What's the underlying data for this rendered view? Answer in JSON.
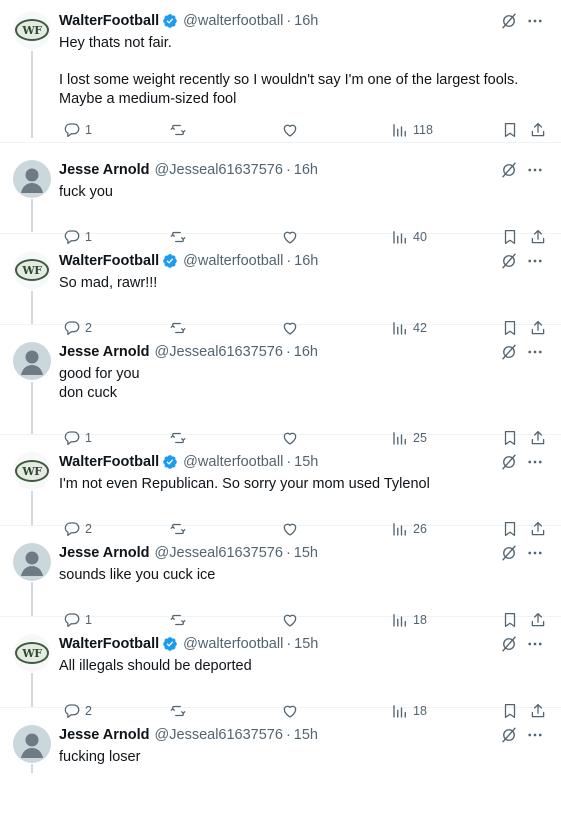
{
  "posts": [
    {
      "author": "WalterFootball",
      "handle": "@walterfootball",
      "time": "16h",
      "verified": true,
      "text": "Hey thats not fair.\n\nI lost some weight recently so I wouldn't say I'm one of the largest fools. Maybe a medium-sized fool",
      "replies": "1",
      "views": "118"
    },
    {
      "author": "Jesse Arnold",
      "handle": "@Jesseal61637576",
      "time": "16h",
      "verified": false,
      "text": "fuck you",
      "replies": "1",
      "views": "40"
    },
    {
      "author": "WalterFootball",
      "handle": "@walterfootball",
      "time": "16h",
      "verified": true,
      "text": "So mad, rawr!!!",
      "replies": "2",
      "views": "42"
    },
    {
      "author": "Jesse Arnold",
      "handle": "@Jesseal61637576",
      "time": "16h",
      "verified": false,
      "text": "good for you\ndon cuck",
      "replies": "1",
      "views": "25"
    },
    {
      "author": "WalterFootball",
      "handle": "@walterfootball",
      "time": "15h",
      "verified": true,
      "text": "I'm not even Republican. So sorry your mom used Tylenol",
      "replies": "2",
      "views": "26"
    },
    {
      "author": "Jesse Arnold",
      "handle": "@Jesseal61637576",
      "time": "15h",
      "verified": false,
      "text": "sounds like  you cuck ice",
      "replies": "1",
      "views": "18"
    },
    {
      "author": "WalterFootball",
      "handle": "@walterfootball",
      "time": "15h",
      "verified": true,
      "text": "All illegals should be deported",
      "replies": "2",
      "views": "18"
    },
    {
      "author": "Jesse Arnold",
      "handle": "@Jesseal61637576",
      "time": "15h",
      "verified": false,
      "text": "fucking loser",
      "replies": "",
      "views": ""
    }
  ],
  "avatar_logo_text": "WF",
  "colors": {
    "text": "#0f1419",
    "muted": "#536471",
    "verified": "#1d9bf0",
    "thread_line": "#cfd9de",
    "separator": "#eff3f4"
  },
  "icons": [
    "verified-badge-icon",
    "grok-icon",
    "more-icon",
    "reply-icon",
    "repost-icon",
    "like-icon",
    "views-icon",
    "bookmark-icon",
    "share-icon"
  ]
}
